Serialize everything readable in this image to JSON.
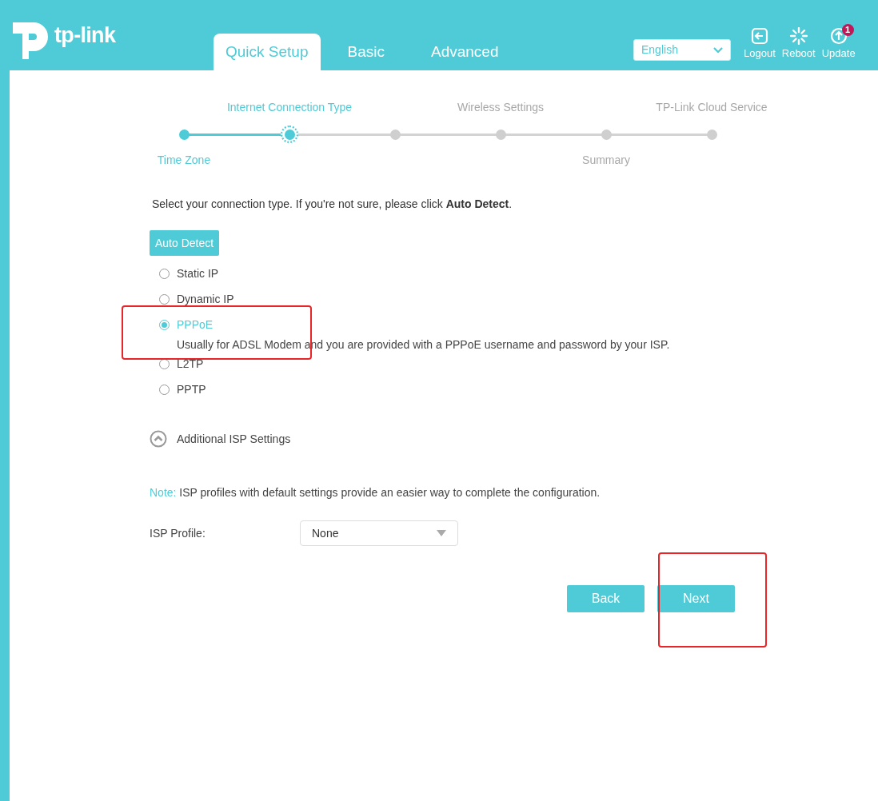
{
  "header": {
    "logo": "tp-link",
    "tabs": [
      {
        "label": "Quick Setup",
        "selected": true
      },
      {
        "label": "Basic",
        "selected": false
      },
      {
        "label": "Advanced",
        "selected": false
      }
    ],
    "language": "English",
    "actions": [
      {
        "kind": "logout",
        "label": "Logout"
      },
      {
        "kind": "reboot",
        "label": "Reboot"
      },
      {
        "kind": "update",
        "label": "Update",
        "badge": "1"
      }
    ]
  },
  "steps": [
    {
      "label_below": "Time Zone",
      "done": true,
      "current": false
    },
    {
      "label_above": "Internet Connection Type",
      "done": false,
      "current": true
    },
    {
      "done": false,
      "current": false
    },
    {
      "label_above": "Wireless Settings",
      "done": false,
      "current": false
    },
    {
      "label_below": "Summary",
      "done": false,
      "current": false
    },
    {
      "label_above": "TP-Link Cloud Service",
      "done": false,
      "current": false
    }
  ],
  "intro": "Select your connection type. If you're not sure, please click **Auto Detect**.",
  "auto_detect": "Auto Detect",
  "options": [
    {
      "label": "Static IP",
      "selected": false
    },
    {
      "label": "Dynamic IP",
      "selected": false
    },
    {
      "label": "PPPoE",
      "selected": true,
      "description": "Usually for ADSL Modem and you are provided with a PPPoE username and password by your ISP."
    },
    {
      "label": "L2TP",
      "selected": false
    },
    {
      "label": "PPTP",
      "selected": false
    }
  ],
  "additional": {
    "label": "Additional ISP Settings",
    "expanded": false
  },
  "note": {
    "label": "Note:",
    "text": "ISP profiles with default settings provide an easier way to complete the configuration."
  },
  "isp_profile": {
    "label": "ISP Profile:",
    "value": "None"
  },
  "buttons": [
    "Back",
    "Next"
  ]
}
